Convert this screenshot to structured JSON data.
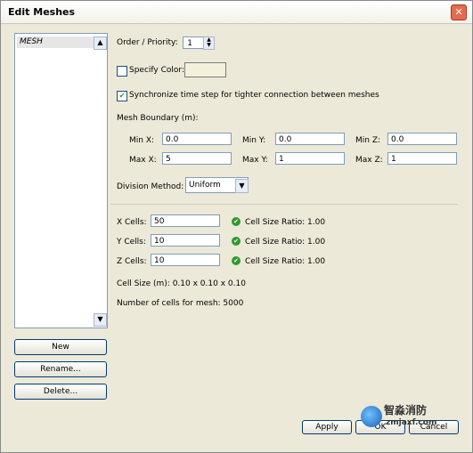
{
  "window": {
    "title": "Edit Meshes"
  },
  "meshes": {
    "items": [
      "MESH"
    ]
  },
  "buttons": {
    "new": "New",
    "rename": "Rename...",
    "delete": "Delete...",
    "apply": "Apply",
    "ok": "OK",
    "cancel": "Cancel"
  },
  "order": {
    "label": "Order / Priority:",
    "value": "1"
  },
  "specify_color": {
    "label": "Specify Color:",
    "checked": false
  },
  "sync": {
    "label": "Synchronize time step for tighter connection between meshes",
    "checked": true
  },
  "boundary": {
    "label": "Mesh Boundary (m):",
    "min_x_label": "Min X:",
    "min_x": "0.0",
    "min_y_label": "Min Y:",
    "min_y": "0.0",
    "min_z_label": "Min Z:",
    "min_z": "0.0",
    "max_x_label": "Max X:",
    "max_x": "5",
    "max_y_label": "Max Y:",
    "max_y": "1",
    "max_z_label": "Max Z:",
    "max_z": "1"
  },
  "division": {
    "label": "Division Method:",
    "value": "Uniform"
  },
  "cells": {
    "x_label": "X Cells:",
    "x": "50",
    "x_ratio": "Cell Size Ratio: 1.00",
    "y_label": "Y Cells:",
    "y": "10",
    "y_ratio": "Cell Size Ratio: 1.00",
    "z_label": "Z Cells:",
    "z": "10",
    "z_ratio": "Cell Size Ratio: 1.00"
  },
  "cell_size": "Cell Size (m): 0.10 x 0.10 x 0.10",
  "cell_count": "Number of cells for mesh: 5000",
  "watermark": {
    "text_cn": "智淼消防",
    "url": "zmjaxf.com"
  }
}
